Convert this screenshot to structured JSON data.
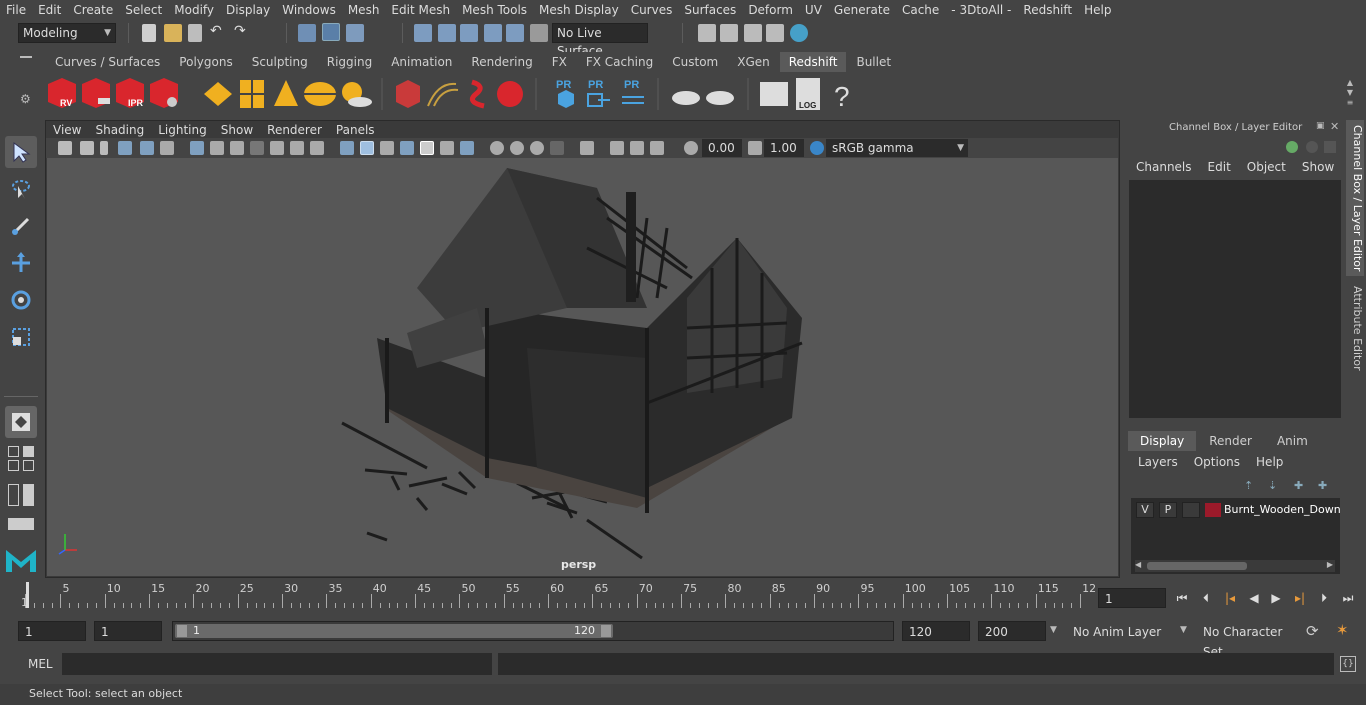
{
  "menu": [
    "File",
    "Edit",
    "Create",
    "Select",
    "Modify",
    "Display",
    "Windows",
    "Mesh",
    "Edit Mesh",
    "Mesh Tools",
    "Mesh Display",
    "Curves",
    "Surfaces",
    "Deform",
    "UV",
    "Generate",
    "Cache",
    "- 3DtoAll -",
    "Redshift",
    "Help"
  ],
  "statusline": {
    "mode": "Modeling",
    "live_surface": "No Live Surface"
  },
  "shelf": {
    "tabs": [
      "Curves / Surfaces",
      "Polygons",
      "Sculpting",
      "Rigging",
      "Animation",
      "Rendering",
      "FX",
      "FX Caching",
      "Custom",
      "XGen",
      "Redshift",
      "Bullet"
    ],
    "active_tab": "Redshift",
    "icon_labels": {
      "rv": "RV",
      "ipr": "IPR",
      "pr": "PR",
      "log": "LOG",
      "help": "?"
    }
  },
  "viewport": {
    "menu": [
      "View",
      "Shading",
      "Lighting",
      "Show",
      "Renderer",
      "Panels"
    ],
    "exposure": "0.00",
    "gamma": "1.00",
    "color_space": "sRGB gamma",
    "camera": "persp"
  },
  "channel_box": {
    "title": "Channel Box / Layer Editor",
    "menu": [
      "Channels",
      "Edit",
      "Object",
      "Show"
    ]
  },
  "layer_editor": {
    "tabs": [
      "Display",
      "Render",
      "Anim"
    ],
    "active_tab": "Display",
    "menu": [
      "Layers",
      "Options",
      "Help"
    ],
    "layer": {
      "v": "V",
      "p": "P",
      "name": "Burnt_Wooden_Down",
      "color": "#9b1a2a"
    }
  },
  "side_tabs": [
    "Channel Box / Layer Editor",
    "Attribute Editor"
  ],
  "time_slider": {
    "tick_labels": [
      "1",
      "5",
      "10",
      "15",
      "20",
      "25",
      "30",
      "35",
      "40",
      "45",
      "50",
      "55",
      "60",
      "65",
      "70",
      "75",
      "80",
      "85",
      "90",
      "95",
      "100",
      "105",
      "110",
      "115",
      "12"
    ],
    "current_frame": "1"
  },
  "range": {
    "start": "1",
    "current": "1",
    "slider_start": "1",
    "slider_end": "120",
    "end": "120",
    "total": "200",
    "anim_layer": "No Anim Layer",
    "char_set": "No Character Set"
  },
  "command": {
    "label": "MEL"
  },
  "help_line": "Select Tool: select an object"
}
